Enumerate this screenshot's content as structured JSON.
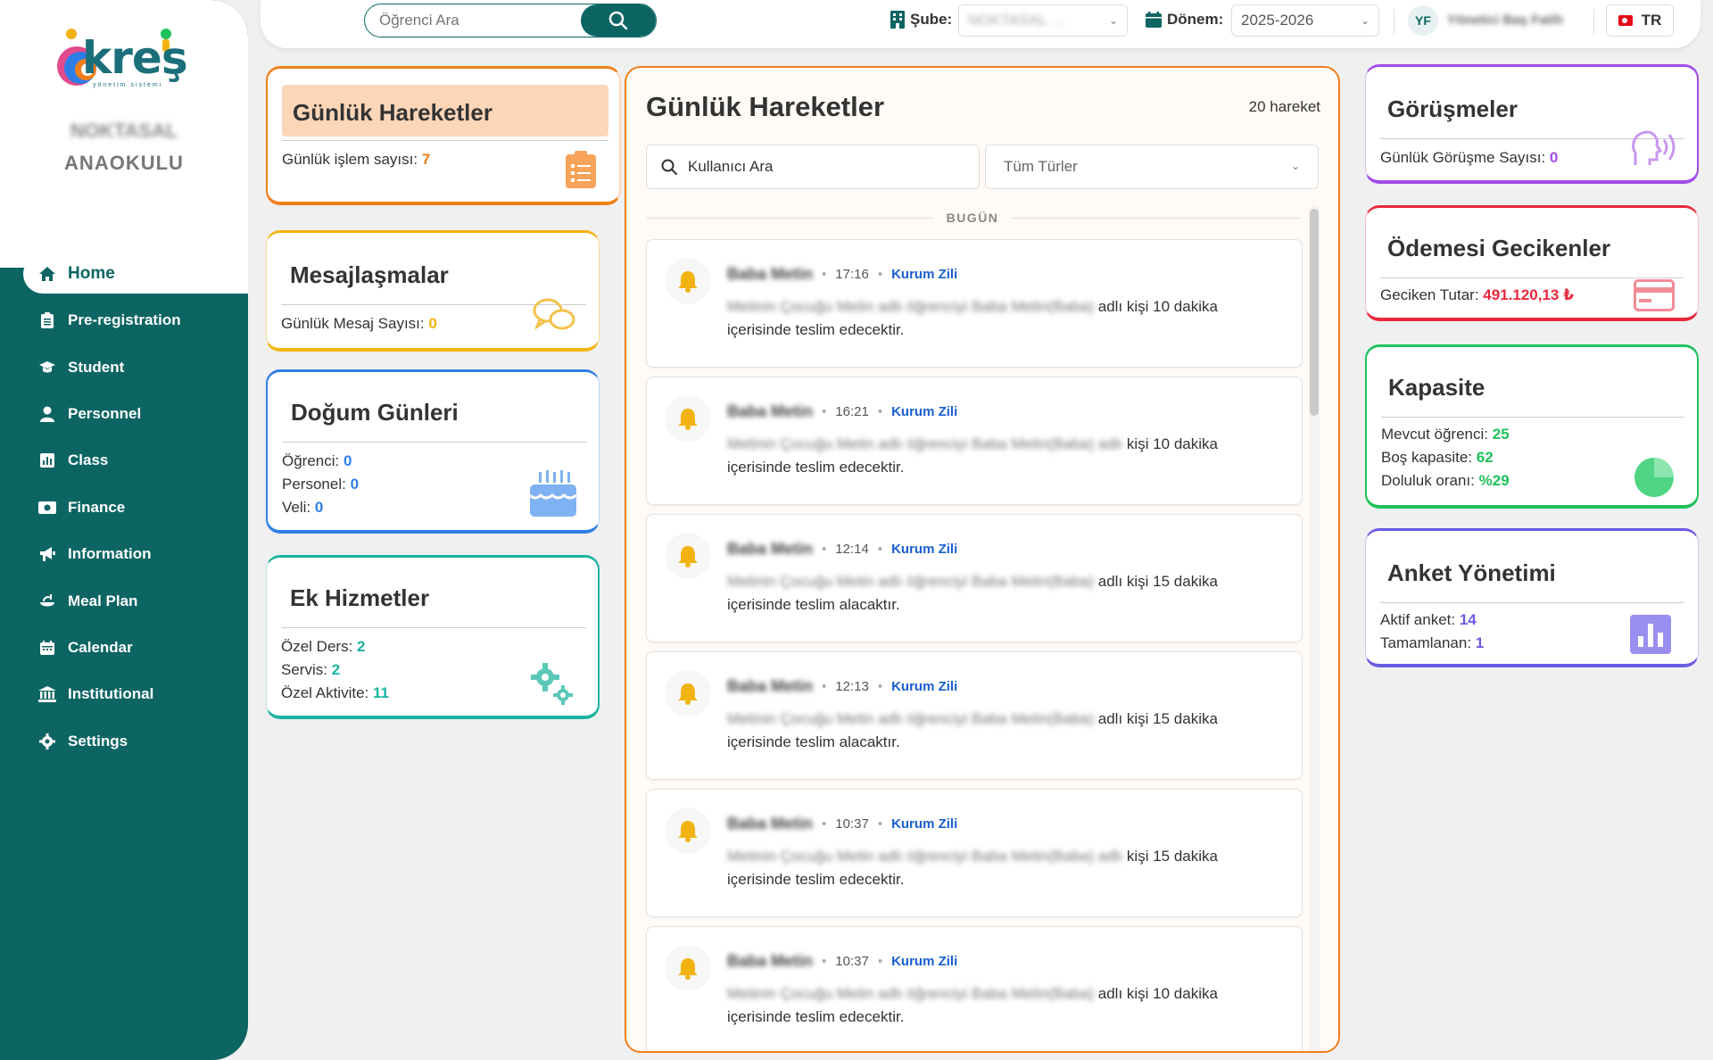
{
  "brand": {
    "logo_text": "kreş",
    "logo_sub": "yönetim sistemi",
    "school_name_line1": "NOKTASAL",
    "school_name_line2": "ANAOKULU"
  },
  "nav": [
    {
      "label": "Home",
      "icon": "home-icon",
      "active": true
    },
    {
      "label": "Pre-registration",
      "icon": "clipboard-icon"
    },
    {
      "label": "Student",
      "icon": "graduation-cap-icon"
    },
    {
      "label": "Personnel",
      "icon": "user-icon"
    },
    {
      "label": "Class",
      "icon": "bar-chart-icon"
    },
    {
      "label": "Finance",
      "icon": "money-icon"
    },
    {
      "label": "Information",
      "icon": "megaphone-icon"
    },
    {
      "label": "Meal Plan",
      "icon": "meal-icon"
    },
    {
      "label": "Calendar",
      "icon": "calendar-icon"
    },
    {
      "label": "Institutional",
      "icon": "institution-icon"
    },
    {
      "label": "Settings",
      "icon": "gear-icon"
    }
  ],
  "header": {
    "search_placeholder": "Öğrenci Ara",
    "sube_label": "Şube:",
    "sube_value": "NOKTASAL ...",
    "donem_label": "Dönem:",
    "donem_value": "2025-2026",
    "avatar_initials": "YF",
    "user_name": "Yönetici Baş Fatih",
    "lang": "TR"
  },
  "cards_left": {
    "gunluk": {
      "title": "Günlük Hareketler",
      "label": "Günlük işlem sayısı:",
      "value": "7"
    },
    "mesaj": {
      "title": "Mesajlaşmalar",
      "label": "Günlük Mesaj Sayısı:",
      "value": "0"
    },
    "dogum": {
      "title": "Doğum Günleri",
      "r1_label": "Öğrenci:",
      "r1_value": "0",
      "r2_label": "Personel:",
      "r2_value": "0",
      "r3_label": "Veli:",
      "r3_value": "0"
    },
    "ek": {
      "title": "Ek Hizmetler",
      "r1_label": "Özel Ders:",
      "r1_value": "2",
      "r2_label": "Servis:",
      "r2_value": "2",
      "r3_label": "Özel Aktivite:",
      "r3_value": "11"
    }
  },
  "cards_right": {
    "gorusme": {
      "title": "Görüşmeler",
      "label": "Günlük Görüşme Sayısı:",
      "value": "0"
    },
    "odeme": {
      "title": "Ödemesi Gecikenler",
      "label": "Geciken Tutar:",
      "value": "491.120,13 ₺"
    },
    "kapasite": {
      "title": "Kapasite",
      "r1_label": "Mevcut öğrenci:",
      "r1_value": "25",
      "r2_label": "Boş kapasite:",
      "r2_value": "62",
      "r3_label": "Doluluk oranı:",
      "r3_value": "%29"
    },
    "anket": {
      "title": "Anket Yönetimi",
      "r1_label": "Aktif anket:",
      "r1_value": "14",
      "r2_label": "Tamamlanan:",
      "r2_value": "1"
    }
  },
  "feed": {
    "title": "Günlük Hareketler",
    "count": "20 hareket",
    "search_placeholder": "Kullanıcı Ara",
    "filter_value": "Tüm Türler",
    "day_label": "BUGÜN",
    "events": [
      {
        "user": "Baba Metin",
        "time": "17:16",
        "type": "Kurum Zili",
        "blur_text": "Metinin Çocuğu Metin adlı öğrenciyi Baba Metin(Baba)",
        "text": " adlı kişi 10 dakika içerisinde teslim edecektir."
      },
      {
        "user": "Baba Metin",
        "time": "16:21",
        "type": "Kurum Zili",
        "blur_text": "Metinin Çocuğu Metin adlı öğrenciyi Baba Metin(Baba) adlı",
        "text": " kişi 10 dakika içerisinde teslim edecektir."
      },
      {
        "user": "Baba Metin",
        "time": "12:14",
        "type": "Kurum Zili",
        "blur_text": "Metinin Çocuğu Metin adlı öğrenciyi Baba Metin(Baba)",
        "text": " adlı kişi 15 dakika içerisinde teslim alacaktır."
      },
      {
        "user": "Baba Metin",
        "time": "12:13",
        "type": "Kurum Zili",
        "blur_text": "Metinin Çocuğu Metin adlı öğrenciyi Baba Metin(Baba)",
        "text": " adlı kişi 15 dakika içerisinde teslim alacaktır."
      },
      {
        "user": "Baba Metin",
        "time": "10:37",
        "type": "Kurum Zili",
        "blur_text": "Metinin Çocuğu Metin adlı öğrenciyi Baba Metin(Baba) adlı",
        "text": " kişi 15 dakika içerisinde teslim edecektir."
      },
      {
        "user": "Baba Metin",
        "time": "10:37",
        "type": "Kurum Zili",
        "blur_text": "Metinin Çocuğu Metin adlı öğrenciyi Baba Metin(Baba)",
        "text": " adlı kişi 10 dakika içerisinde teslim edecektir."
      }
    ]
  },
  "colors": {
    "primary": "#0c6563",
    "orange": "#f07f1a",
    "yellow": "#f2b311",
    "blue": "#2f7ee8",
    "teal": "#1ab5a0",
    "purple": "#a24ce8",
    "red": "#e9283c",
    "green": "#1fc25a",
    "indigo": "#6a5be3"
  }
}
